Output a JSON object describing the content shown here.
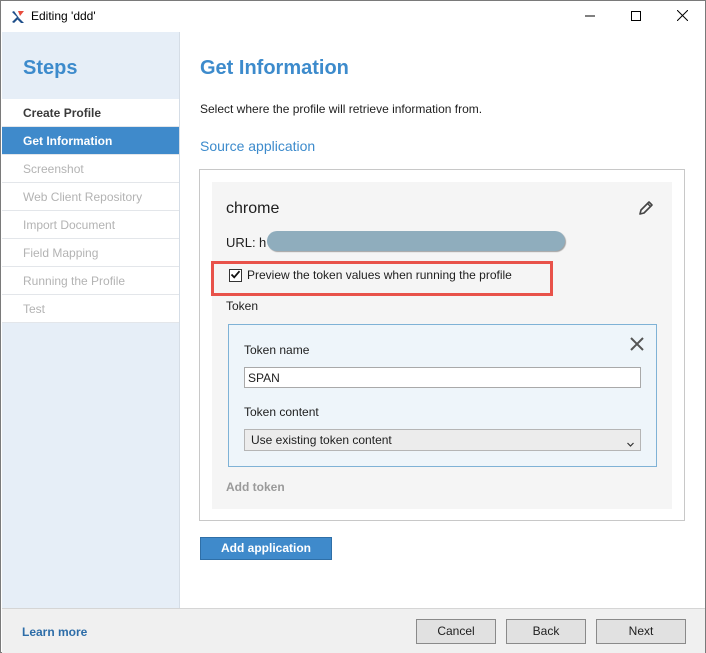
{
  "window": {
    "title": "Editing 'ddd'"
  },
  "sidebar": {
    "title": "Steps",
    "items": [
      {
        "label": "Create Profile",
        "state": "done"
      },
      {
        "label": "Get Information",
        "state": "active"
      },
      {
        "label": "Screenshot",
        "state": "disabled"
      },
      {
        "label": "Web Client Repository",
        "state": "disabled"
      },
      {
        "label": "Import Document",
        "state": "disabled"
      },
      {
        "label": "Field Mapping",
        "state": "disabled"
      },
      {
        "label": "Running the Profile",
        "state": "disabled"
      },
      {
        "label": "Test",
        "state": "disabled"
      }
    ]
  },
  "main": {
    "title": "Get Information",
    "description": "Select where the profile will retrieve information from.",
    "section_label": "Source application",
    "application": {
      "name": "chrome",
      "url_label": "URL:",
      "url_value": "h",
      "preview_checkbox": {
        "checked": true,
        "label": "Preview the token values when running the profile"
      },
      "token_heading": "Token",
      "token": {
        "name_label": "Token name",
        "name_value": "SPAN",
        "content_label": "Token content",
        "content_value": "Use existing token content"
      },
      "add_token_label": "Add token"
    },
    "add_application_label": "Add application"
  },
  "footer": {
    "learn_more": "Learn more",
    "cancel": "Cancel",
    "back": "Back",
    "next": "Next"
  },
  "colors": {
    "accent": "#3d8bcc",
    "active_step_bg": "#3f8acb",
    "highlight_border": "#e8524a",
    "sidebar_bg": "#e6eef7"
  },
  "icons": {
    "app": "app-logo-icon",
    "minimize": "minimize-icon",
    "maximize": "maximize-icon",
    "close": "close-icon",
    "edit": "pencil-icon",
    "remove_token": "close-x-icon",
    "dropdown": "chevron-down-icon"
  }
}
